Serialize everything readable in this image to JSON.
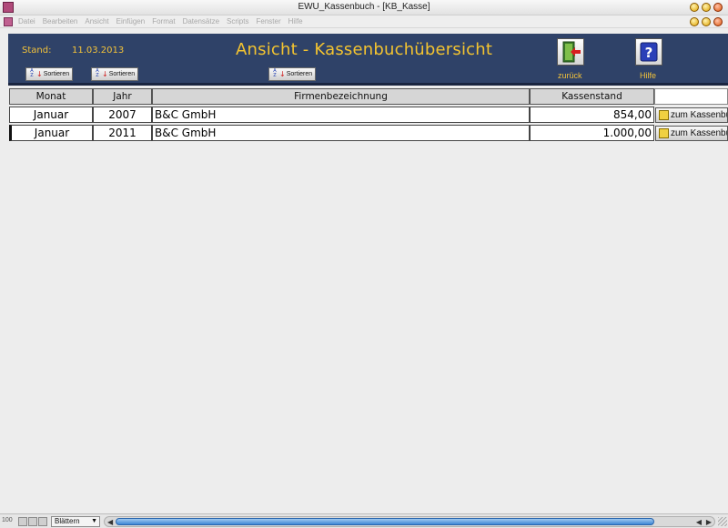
{
  "window": {
    "title": "EWU_Kassenbuch - [KB_Kasse]"
  },
  "menu": [
    "Datei",
    "Bearbeiten",
    "Ansicht",
    "Einfügen",
    "Format",
    "Datensätze",
    "Scripts",
    "Fenster",
    "Hilfe"
  ],
  "header": {
    "stand_label": "Stand:",
    "stand_date": "11.03.2013",
    "title": "Ansicht - Kassenbuchübersicht",
    "sort_label": "Sortieren",
    "back_label": "zurück",
    "help_label": "Hilfe",
    "help_icon_glyph": "?"
  },
  "colors": {
    "header_bg": "#2f4268",
    "accent_text": "#f4c430",
    "scroll_thumb": "#3e86d6"
  },
  "table": {
    "columns": [
      "Monat",
      "Jahr",
      "Firmenbezeichnung",
      "Kassenstand"
    ],
    "rows": [
      {
        "monat": "Januar",
        "jahr": "2007",
        "firma": "B&C GmbH",
        "kassenstand": "854,00",
        "button": "zum Kassenbuch"
      },
      {
        "monat": "Januar",
        "jahr": "2011",
        "firma": "B&C GmbH",
        "kassenstand": "1.000,00",
        "button": "zum Kassenbuch"
      }
    ]
  },
  "status": {
    "zoom": "100",
    "mode": "Blättern"
  }
}
